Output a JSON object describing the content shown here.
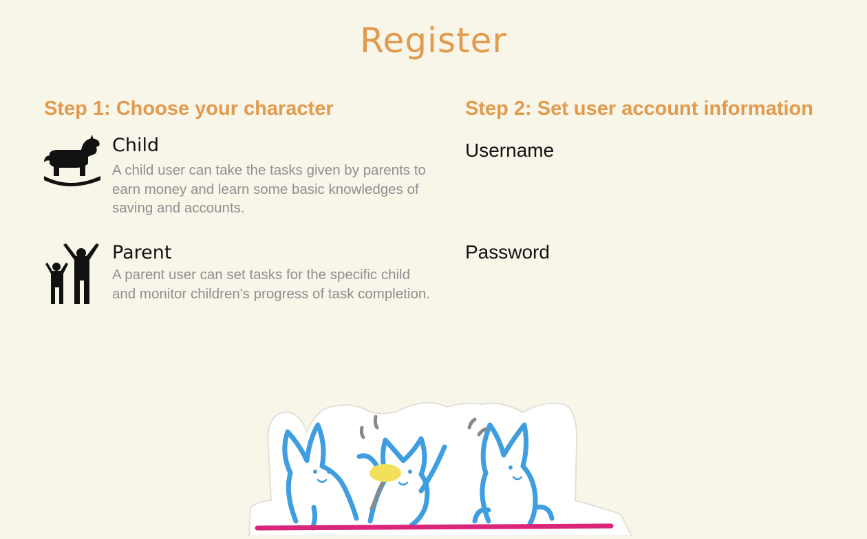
{
  "page": {
    "title": "Register"
  },
  "step1": {
    "heading": "Step 1: Choose your character",
    "roles": [
      {
        "name": "Child",
        "icon": "rocking-horse-icon",
        "description": "A child user can take the tasks given by parents to earn money and learn some basic knowledges of saving and accounts."
      },
      {
        "name": "Parent",
        "icon": "parent-and-child-icon",
        "description": "A parent user can set tasks for the specific child and monitor children's progress of task completion."
      }
    ]
  },
  "step2": {
    "heading": "Step 2: Set user account information",
    "username": {
      "label": "Username",
      "value": "",
      "placeholder": ""
    },
    "password": {
      "label": "Password",
      "value": "",
      "placeholder": ""
    }
  },
  "illustration": {
    "icon": "three-bunnies-illustration"
  },
  "colors": {
    "accent": "#e29a4c",
    "background": "#f8f5e9",
    "description_text": "#8f8f8f",
    "bunny_outline": "#3e9ee0",
    "table_line": "#d9257a",
    "lightbulb": "#f2e05a"
  }
}
